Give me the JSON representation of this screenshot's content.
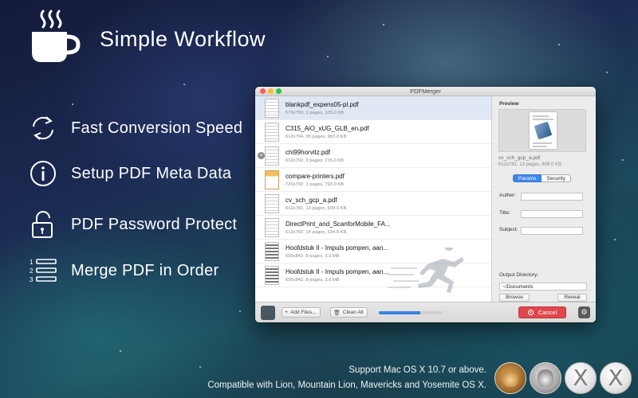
{
  "hero": {
    "title": "Simple Workflow",
    "icon": "coffee-cup-icon"
  },
  "features": [
    {
      "label": "Fast Conversion Speed",
      "icon": "sync-arrows-icon"
    },
    {
      "label": "Setup PDF Meta Data",
      "icon": "info-icon"
    },
    {
      "label": "PDF Password Protect",
      "icon": "open-lock-icon"
    },
    {
      "label": "Merge PDF in Order",
      "icon": "numbered-list-icon"
    }
  ],
  "window": {
    "title": "PDFMerger",
    "files": [
      {
        "name": "blankpdf_expens05-pl.pdf",
        "meta": "576x759, 1 pages, 105.0 KB",
        "selected": true
      },
      {
        "name": "C315_AiO_xUG_GLB_en.pdf",
        "meta": "612x794, 95 pages, 983.0 KB"
      },
      {
        "name": "chi99horvitz.pdf",
        "meta": "612x792, 9 pages, 215.0 KB",
        "hover": true
      },
      {
        "name": "compare-printers.pdf",
        "meta": "720x792, 1 pages, 793.0 KB"
      },
      {
        "name": "cv_sch_gcp_a.pdf",
        "meta": "612x781, 13 pages, 609.0 KB"
      },
      {
        "name": "DirectPrint_and_ScanforMobile_FA...",
        "meta": "612x792, 14 pages, 534.0 KB"
      },
      {
        "name": "Hoofdstuk II - Impuls pompen, aan...",
        "meta": "595x842, 8 pages, 3.9 MB"
      },
      {
        "name": "Hoofdstuk II - Impuls pompen, aan...",
        "meta": "595x842, 8 pages, 3.6 MB"
      }
    ],
    "remove_symbol": "×",
    "toolbar": {
      "add_files_label": "Add Files...",
      "add_files_icon": "+",
      "clear_all_label": "Clean All",
      "clear_all_icon": "🗑",
      "progress": 0.65,
      "cancel_label": "Cancel",
      "gear_symbol": "⚙"
    },
    "preview": {
      "label": "Preview",
      "name": "cv_sch_gcp_a.pdf",
      "meta": "612x781, 13 pages, 609.0 KB"
    },
    "tabs": [
      {
        "label": "Params",
        "active": true
      },
      {
        "label": "Security",
        "active": false
      }
    ],
    "fields": {
      "author_label": "Auther:",
      "title_label": "Title:",
      "subject_label": "Subject:"
    },
    "output": {
      "label": "Output Directory:",
      "value": "~/Documents",
      "browse_label": "Browse",
      "reveal_label": "Reveal"
    }
  },
  "footer": {
    "support": "Support Mac OS X 10.7 or above.",
    "compat": "Compatible with Lion, Mountain Lion, Mavericks and Yosemite OS X.",
    "badges": [
      {
        "name": "lion-badge"
      },
      {
        "name": "mountain-lion-badge"
      },
      {
        "name": "mavericks-badge",
        "glyph": "X"
      },
      {
        "name": "yosemite-badge",
        "glyph": "X"
      }
    ]
  },
  "colors": {
    "accent": "#3f86ea",
    "cancel": "#e0474c",
    "selection": "#dfe8f4"
  }
}
